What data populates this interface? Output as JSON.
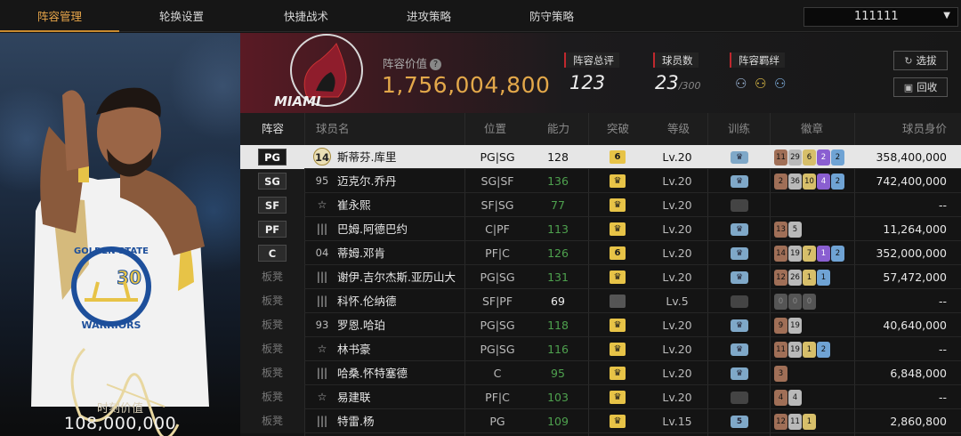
{
  "nav": {
    "tabs": [
      "阵容管理",
      "轮换设置",
      "快捷战术",
      "进攻策略",
      "防守策略"
    ],
    "active_tab": 0,
    "user_select": "111111"
  },
  "card": {
    "value_label": "时刻价值",
    "value": "108,000,000"
  },
  "header": {
    "team_logo_text": "MIAMI",
    "lineup_value_label": "阵容价值",
    "lineup_value": "1,756,004,800",
    "rating_label": "阵容总评",
    "rating": "123",
    "player_count_label": "球员数",
    "player_count": "23",
    "player_count_max": "/300",
    "bond_label": "阵容羁绊",
    "pick_button": "选拔",
    "recycle_button": "回收"
  },
  "table": {
    "headers": {
      "lineup": "阵容",
      "name": "球员名",
      "position": "位置",
      "ability": "能力",
      "breakthrough": "突破",
      "level": "等级",
      "training": "训练",
      "badges": "徽章",
      "price": "球员身价"
    },
    "rows": [
      {
        "slot": "PG",
        "jersey": "14",
        "jersey_style": "gold",
        "name": "斯蒂芬.库里",
        "position": "PG|SG",
        "ability": "128",
        "breakthrough": "6",
        "level": "Lv.20",
        "training": "active",
        "badges": [
          [
            "11",
            "c1"
          ],
          [
            "29",
            "c2"
          ],
          [
            "6",
            "c3"
          ],
          [
            "2",
            "c4"
          ],
          [
            "2",
            "c5"
          ]
        ],
        "price": "358,400,000"
      },
      {
        "slot": "SG",
        "jersey": "95",
        "jersey_style": "num",
        "name": "迈克尔.乔丹",
        "position": "SG|SF",
        "ability": "136",
        "breakthrough": "crown",
        "level": "Lv.20",
        "training": "active",
        "badges": [
          [
            "2",
            "c1"
          ],
          [
            "36",
            "c2"
          ],
          [
            "10",
            "c3"
          ],
          [
            "4",
            "c4"
          ],
          [
            "2",
            "c5"
          ]
        ],
        "price": "742,400,000"
      },
      {
        "slot": "SF",
        "jersey": "☆",
        "jersey_style": "icon",
        "name": "崔永熙",
        "position": "SF|SG",
        "ability": "77",
        "breakthrough": "crown",
        "level": "Lv.20",
        "training": "none",
        "badges": [],
        "price": "--"
      },
      {
        "slot": "PF",
        "jersey": "|||",
        "jersey_style": "icon",
        "name": "巴姆.阿德巴约",
        "position": "C|PF",
        "ability": "113",
        "breakthrough": "crown",
        "level": "Lv.20",
        "training": "active",
        "badges": [
          [
            "13",
            "c1"
          ],
          [
            "5",
            "c2"
          ]
        ],
        "price": "11,264,000"
      },
      {
        "slot": "C",
        "jersey": "04",
        "jersey_style": "num",
        "name": "蒂姆.邓肯",
        "position": "PF|C",
        "ability": "126",
        "breakthrough": "6",
        "level": "Lv.20",
        "training": "active",
        "badges": [
          [
            "14",
            "c1"
          ],
          [
            "19",
            "c2"
          ],
          [
            "7",
            "c3"
          ],
          [
            "1",
            "c4"
          ],
          [
            "2",
            "c5"
          ]
        ],
        "price": "352,000,000"
      },
      {
        "slot": "板凳",
        "jersey": "|||",
        "jersey_style": "icon",
        "name": "谢伊.吉尔杰斯.亚历山大",
        "position": "PG|SG",
        "ability": "131",
        "breakthrough": "crown",
        "level": "Lv.20",
        "training": "active",
        "badges": [
          [
            "12",
            "c1"
          ],
          [
            "26",
            "c2"
          ],
          [
            "1",
            "c3"
          ],
          [
            "1",
            "c5"
          ]
        ],
        "price": "57,472,000"
      },
      {
        "slot": "板凳",
        "jersey": "|||",
        "jersey_style": "icon",
        "name": "科怀.伦纳德",
        "position": "SF|PF",
        "ability": "69",
        "breakthrough": "grey",
        "level": "Lv.5",
        "training": "none",
        "badges": [
          [
            "0",
            "c6"
          ],
          [
            "0",
            "c6"
          ],
          [
            "0",
            "c6"
          ]
        ],
        "price": "--"
      },
      {
        "slot": "板凳",
        "jersey": "93",
        "jersey_style": "num",
        "name": "罗恩.哈珀",
        "position": "PG|SG",
        "ability": "118",
        "breakthrough": "crown",
        "level": "Lv.20",
        "training": "active",
        "badges": [
          [
            "9",
            "c1"
          ],
          [
            "19",
            "c2"
          ]
        ],
        "price": "40,640,000"
      },
      {
        "slot": "板凳",
        "jersey": "☆",
        "jersey_style": "icon",
        "name": "林书豪",
        "position": "PG|SG",
        "ability": "116",
        "breakthrough": "crown",
        "level": "Lv.20",
        "training": "active",
        "badges": [
          [
            "11",
            "c1"
          ],
          [
            "19",
            "c2"
          ],
          [
            "1",
            "c3"
          ],
          [
            "2",
            "c5"
          ]
        ],
        "price": "--"
      },
      {
        "slot": "板凳",
        "jersey": "|||",
        "jersey_style": "icon",
        "name": "哈桑.怀特塞德",
        "position": "C",
        "ability": "95",
        "breakthrough": "crown",
        "level": "Lv.20",
        "training": "active",
        "badges": [
          [
            "3",
            "c1"
          ]
        ],
        "price": "6,848,000"
      },
      {
        "slot": "板凳",
        "jersey": "☆",
        "jersey_style": "icon",
        "name": "易建联",
        "position": "PF|C",
        "ability": "103",
        "breakthrough": "crown",
        "level": "Lv.20",
        "training": "none",
        "badges": [
          [
            "4",
            "c1"
          ],
          [
            "4",
            "c2"
          ]
        ],
        "price": "--"
      },
      {
        "slot": "板凳",
        "jersey": "|||",
        "jersey_style": "icon",
        "name": "特雷.杨",
        "position": "PG",
        "ability": "109",
        "breakthrough": "crown",
        "level": "Lv.15",
        "training": "5",
        "badges": [
          [
            "12",
            "c1"
          ],
          [
            "11",
            "c2"
          ],
          [
            "1",
            "c3"
          ]
        ],
        "price": "2,860,800"
      }
    ]
  }
}
